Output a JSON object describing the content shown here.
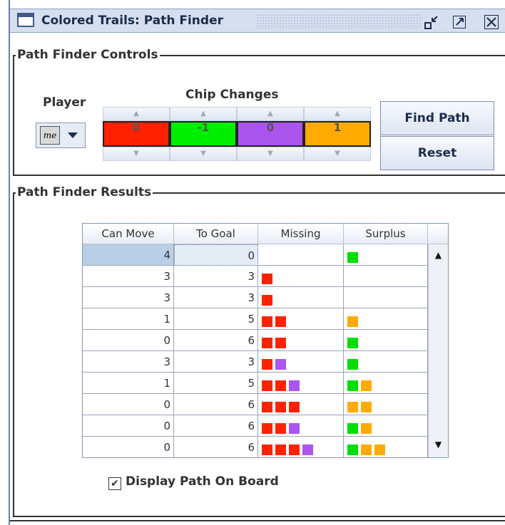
{
  "window": {
    "title": "Colored Trails: Path Finder",
    "buttons": {
      "minimize_icon": "minimize-icon",
      "maximize_icon": "maximize-icon",
      "close_icon": "close-icon"
    }
  },
  "controls": {
    "legend": "Path Finder Controls",
    "player_label": "Player",
    "player_value": "me",
    "chip_changes_label": "Chip Changes",
    "chips": [
      {
        "value": "0",
        "color": "#ff2200"
      },
      {
        "value": "-1",
        "color": "#00ee00"
      },
      {
        "value": "0",
        "color": "#aa55ee"
      },
      {
        "value": "1",
        "color": "#ffaa00"
      }
    ],
    "find_path_label": "Find Path",
    "reset_label": "Reset"
  },
  "results": {
    "legend": "Path Finder Results",
    "columns": [
      "Can Move",
      "To Goal",
      "Missing",
      "Surplus"
    ],
    "colors": {
      "red": "#ff2200",
      "green": "#00dd00",
      "purple": "#aa55ee",
      "orange": "#ffaa00"
    },
    "rows": [
      {
        "can_move": "4",
        "to_goal": "0",
        "missing": [],
        "surplus": [
          "green"
        ],
        "selected": true
      },
      {
        "can_move": "3",
        "to_goal": "3",
        "missing": [
          "red"
        ],
        "surplus": []
      },
      {
        "can_move": "3",
        "to_goal": "3",
        "missing": [
          "red"
        ],
        "surplus": []
      },
      {
        "can_move": "1",
        "to_goal": "5",
        "missing": [
          "red",
          "red"
        ],
        "surplus": [
          "orange"
        ]
      },
      {
        "can_move": "0",
        "to_goal": "6",
        "missing": [
          "red",
          "red"
        ],
        "surplus": [
          "green"
        ]
      },
      {
        "can_move": "3",
        "to_goal": "3",
        "missing": [
          "red",
          "purple"
        ],
        "surplus": [
          "green"
        ]
      },
      {
        "can_move": "1",
        "to_goal": "5",
        "missing": [
          "red",
          "red",
          "purple"
        ],
        "surplus": [
          "green",
          "orange"
        ]
      },
      {
        "can_move": "0",
        "to_goal": "6",
        "missing": [
          "red",
          "red",
          "red"
        ],
        "surplus": [
          "orange",
          "orange"
        ]
      },
      {
        "can_move": "0",
        "to_goal": "6",
        "missing": [
          "red",
          "red",
          "purple"
        ],
        "surplus": [
          "green",
          "orange"
        ]
      },
      {
        "can_move": "0",
        "to_goal": "6",
        "missing": [
          "red",
          "red",
          "red",
          "purple"
        ],
        "surplus": [
          "green",
          "orange",
          "orange"
        ]
      }
    ],
    "display_path_label": "Display Path On Board",
    "display_path_checked": true
  }
}
